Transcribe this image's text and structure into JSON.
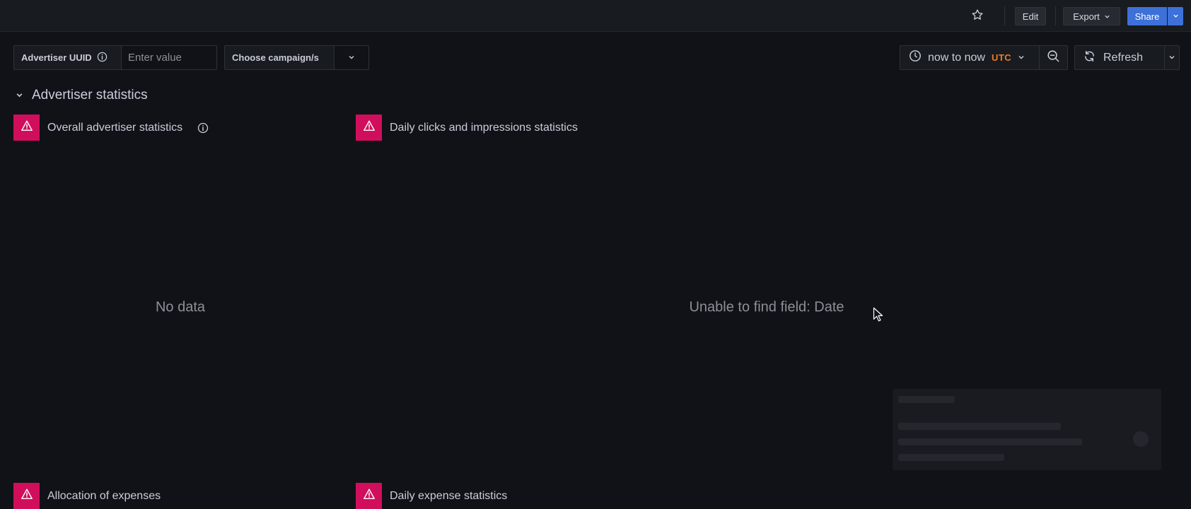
{
  "toolbar": {
    "edit_label": "Edit",
    "export_label": "Export",
    "share_label": "Share"
  },
  "variables": {
    "advertiser": {
      "label": "Advertiser UUID",
      "placeholder": "Enter value",
      "value": ""
    },
    "campaign": {
      "label": "Choose campaign/s"
    }
  },
  "time": {
    "range": "now to now",
    "timezone": "UTC",
    "refresh_label": "Refresh"
  },
  "row": {
    "title": "Advertiser statistics"
  },
  "panels": [
    {
      "title": "Overall advertiser statistics",
      "message": "No data",
      "has_info": true
    },
    {
      "title": "Daily clicks and impressions statistics",
      "message": "Unable to find field: Date",
      "has_info": false
    },
    {
      "title": "Allocation of expenses",
      "message": "",
      "has_info": false
    },
    {
      "title": "Daily expense statistics",
      "message": "",
      "has_info": false
    }
  ],
  "colors": {
    "background": "#111217",
    "accent": "#3d71d9",
    "error": "#d10e5c",
    "timezone": "#f07a2a"
  }
}
